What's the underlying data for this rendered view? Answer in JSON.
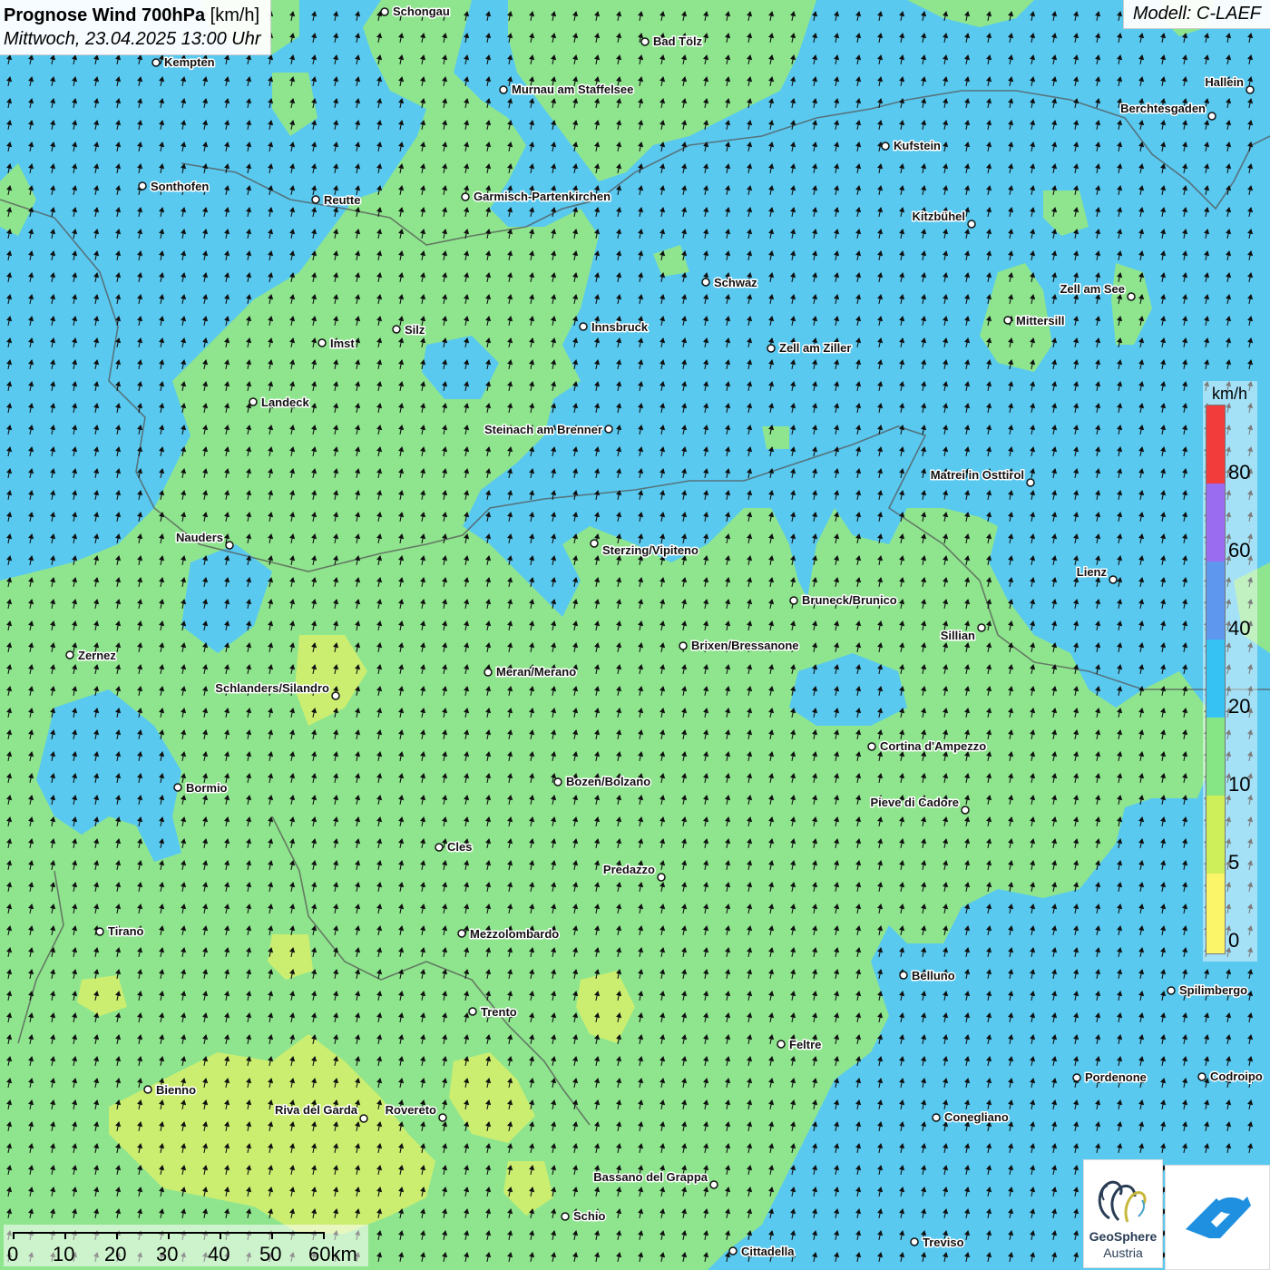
{
  "header": {
    "title_bold": "Prognose Wind 700hPa",
    "title_unit": "[km/h]",
    "datetime": "Mittwoch, 23.04.2025 13:00 Uhr",
    "model": "Modell: C-LAEF"
  },
  "legend": {
    "unit": "km/h",
    "ticks": [
      "80",
      "60",
      "40",
      "20",
      "10",
      "5",
      "0"
    ],
    "colors": [
      "#f23b3b",
      "#9a6cf0",
      "#5e97ee",
      "#36c2f2",
      "#86e585",
      "#cfef5a",
      "#fbf56a"
    ]
  },
  "scale_bar": {
    "ticks": [
      "0",
      "10",
      "20",
      "30",
      "40",
      "50",
      "60km"
    ]
  },
  "map": {
    "zone_colors": {
      "ge20": "#59c9f0",
      "ge10": "#8fe58e",
      "ge5": "#ccee70"
    },
    "wind_direction": "from south-southwest",
    "cities": [
      "Schongau",
      "Bad Tölz",
      "Kempten",
      "Murnau am Staffelsee",
      "Hallein",
      "Berchtesgaden",
      "Kufstein",
      "Sonthofen",
      "Reutte",
      "Garmisch-Partenkirchen",
      "Kitzbühel",
      "Schwaz",
      "Zell am See",
      "Mittersill",
      "Imst",
      "Silz",
      "Innsbruck",
      "Zell am Ziller",
      "Landeck",
      "Steinach am Brenner",
      "Matrei in Osttirol",
      "Nauders",
      "Sterzing/Vipiteno",
      "Lienz",
      "Bruneck/Brunico",
      "Sillian",
      "Zernez",
      "Brixen/Bressanone",
      "Meran/Merano",
      "Schlanders/Silandro",
      "Cortina d'Ampezzo",
      "Bozen/Bolzano",
      "Bormio",
      "Pieve di Cadore",
      "Cles",
      "Predazzo",
      "Tirano",
      "Mezzolombardo",
      "Belluno",
      "Spilimbergo",
      "Trento",
      "Feltre",
      "Pordenone",
      "Codroipo",
      "Bienno",
      "Riva del Garda",
      "Rovereto",
      "Conegliano",
      "Bassano del Grappa",
      "Schio",
      "Treviso",
      "Cittadella"
    ]
  },
  "logos": {
    "geosphere_name": "GeoSphere",
    "geosphere_sub": "Austria"
  }
}
